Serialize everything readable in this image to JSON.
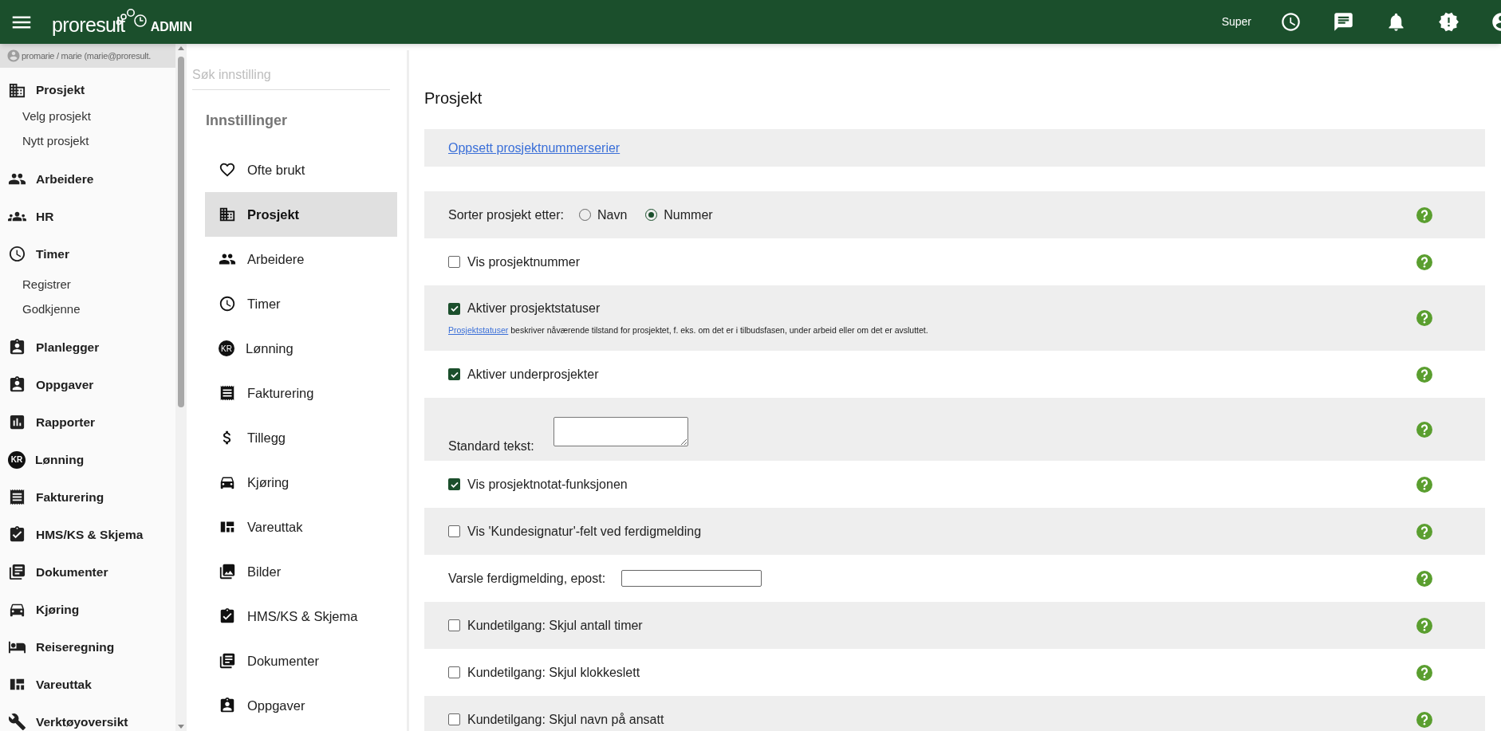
{
  "header": {
    "logo": "proresult",
    "logo_suffix": "ADMIN",
    "user_role": "Super"
  },
  "sidebar": {
    "user": "promarie / marie (marie@proresult.",
    "items": [
      {
        "label": "Prosjekt",
        "children": [
          {
            "label": "Velg prosjekt"
          },
          {
            "label": "Nytt prosjekt"
          }
        ]
      },
      {
        "label": "Arbeidere"
      },
      {
        "label": "HR"
      },
      {
        "label": "Timer",
        "children": [
          {
            "label": "Registrer"
          },
          {
            "label": "Godkjenne"
          }
        ]
      },
      {
        "label": "Planlegger"
      },
      {
        "label": "Oppgaver"
      },
      {
        "label": "Rapporter"
      },
      {
        "label": "Lønning",
        "icon_text": "KR"
      },
      {
        "label": "Fakturering"
      },
      {
        "label": "HMS/KS & Skjema"
      },
      {
        "label": "Dokumenter"
      },
      {
        "label": "Kjøring"
      },
      {
        "label": "Reiseregning"
      },
      {
        "label": "Vareuttak"
      },
      {
        "label": "Verktøyoversikt"
      }
    ]
  },
  "settings_nav": {
    "search": {
      "placeholder": "Søk innstilling"
    },
    "heading": "Innstillinger",
    "items": [
      {
        "label": "Ofte brukt",
        "selected": false
      },
      {
        "label": "Prosjekt",
        "selected": true
      },
      {
        "label": "Arbeidere",
        "selected": false
      },
      {
        "label": "Timer",
        "selected": false
      },
      {
        "label": "Lønning",
        "selected": false,
        "icon_text": "KR"
      },
      {
        "label": "Fakturering",
        "selected": false
      },
      {
        "label": "Tillegg",
        "selected": false
      },
      {
        "label": "Kjøring",
        "selected": false
      },
      {
        "label": "Vareuttak",
        "selected": false
      },
      {
        "label": "Bilder",
        "selected": false
      },
      {
        "label": "HMS/KS & Skjema",
        "selected": false
      },
      {
        "label": "Dokumenter",
        "selected": false
      },
      {
        "label": "Oppgaver",
        "selected": false
      }
    ]
  },
  "content": {
    "title": "Prosjekt",
    "link": "Oppsett prosjektnummerserier",
    "settings": [
      {
        "kind": "radio",
        "label": "Sorter prosjekt etter:",
        "options": [
          {
            "label": "Navn",
            "selected": false
          },
          {
            "label": "Nummer",
            "selected": true
          }
        ]
      },
      {
        "kind": "checkbox",
        "label": "Vis prosjektnummer",
        "checked": false
      },
      {
        "kind": "checkbox",
        "label": "Aktiver prosjektstatuser",
        "checked": true,
        "description": {
          "link": "Prosjektstatuser",
          "text": " beskriver nåværende tilstand for prosjektet, f. eks. om det er i tilbudsfasen, under arbeid eller om det er avsluttet."
        }
      },
      {
        "kind": "checkbox",
        "label": "Aktiver underprosjekter",
        "checked": true
      },
      {
        "kind": "textarea",
        "label": "Standard tekst:"
      },
      {
        "kind": "checkbox",
        "label": "Vis prosjektnotat-funksjonen",
        "checked": true
      },
      {
        "kind": "checkbox",
        "label": "Vis 'Kundesignatur'-felt ved ferdigmelding",
        "checked": false
      },
      {
        "kind": "input",
        "label": "Varsle ferdigmelding, epost:"
      },
      {
        "kind": "checkbox",
        "label": "Kundetilgang: Skjul antall timer",
        "checked": false
      },
      {
        "kind": "checkbox",
        "label": "Kundetilgang: Skjul klokkeslett",
        "checked": false
      },
      {
        "kind": "checkbox",
        "label": "Kundetilgang: Skjul navn på ansatt",
        "checked": false
      }
    ]
  }
}
